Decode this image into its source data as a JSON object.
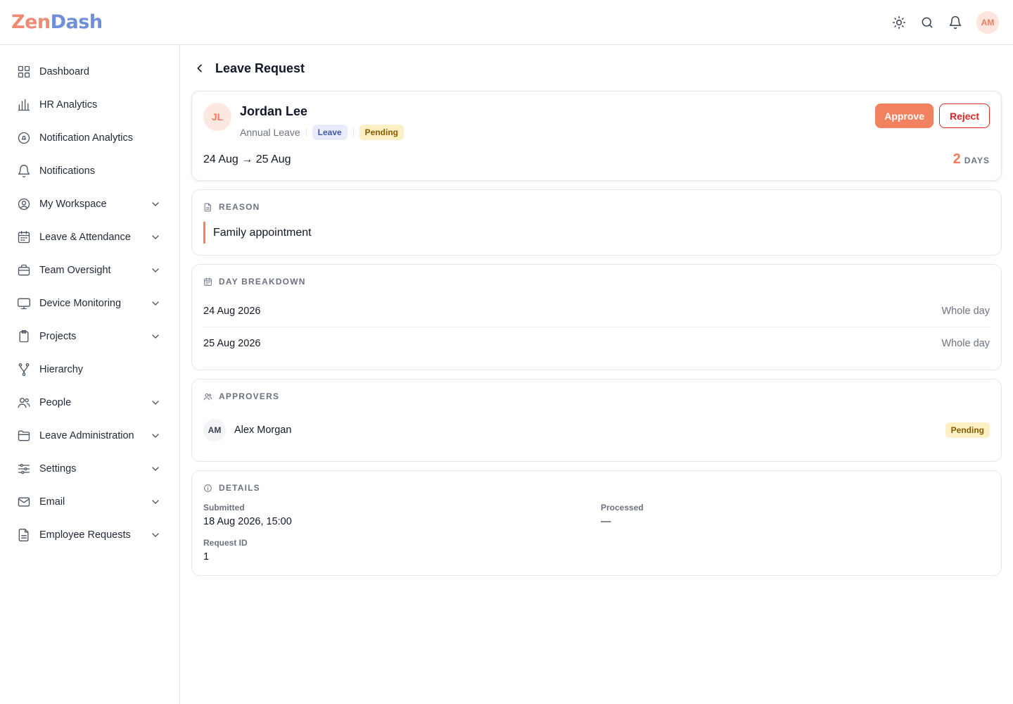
{
  "app": {
    "logo_part1": "Zen",
    "logo_part2": "Dash",
    "user_initials": "AM"
  },
  "topbar_icons": [
    "sun-icon",
    "search-icon",
    "bell-icon"
  ],
  "sidebar": {
    "items": [
      {
        "label": "Dashboard",
        "icon": "grid-icon",
        "expandable": false
      },
      {
        "label": "HR Analytics",
        "icon": "bar-chart-icon",
        "expandable": false
      },
      {
        "label": "Notification Analytics",
        "icon": "circle-bell-icon",
        "expandable": false
      },
      {
        "label": "Notifications",
        "icon": "bell-icon",
        "expandable": false
      },
      {
        "label": "My Workspace",
        "icon": "user-circle-icon",
        "expandable": true
      },
      {
        "label": "Leave & Attendance",
        "icon": "calendar-icon",
        "expandable": true
      },
      {
        "label": "Team Oversight",
        "icon": "briefcase-icon",
        "expandable": true
      },
      {
        "label": "Device Monitoring",
        "icon": "monitor-icon",
        "expandable": true
      },
      {
        "label": "Projects",
        "icon": "clipboard-icon",
        "expandable": true
      },
      {
        "label": "Hierarchy",
        "icon": "fork-icon",
        "expandable": false
      },
      {
        "label": "People",
        "icon": "users-icon",
        "expandable": true
      },
      {
        "label": "Leave Administration",
        "icon": "folder-icon",
        "expandable": true
      },
      {
        "label": "Settings",
        "icon": "sliders-icon",
        "expandable": true
      },
      {
        "label": "Email",
        "icon": "mail-icon",
        "expandable": true
      },
      {
        "label": "Employee Requests",
        "icon": "document-icon",
        "expandable": true
      }
    ]
  },
  "page": {
    "title": "Leave Request"
  },
  "request": {
    "initials": "JL",
    "name": "Jordan Lee",
    "leave_type": "Annual Leave",
    "category_badge": "Leave",
    "status_badge": "Pending",
    "date_range": "24 Aug → 25 Aug",
    "days_count": "2",
    "days_unit": "DAYS",
    "approve_label": "Approve",
    "reject_label": "Reject"
  },
  "reason": {
    "title": "REASON",
    "text": "Family appointment"
  },
  "breakdown": {
    "title": "DAY BREAKDOWN",
    "rows": [
      {
        "date": "24 Aug 2026",
        "type": "Whole day"
      },
      {
        "date": "25 Aug 2026",
        "type": "Whole day"
      }
    ]
  },
  "approvers": {
    "title": "APPROVERS",
    "list": [
      {
        "initials": "AM",
        "name": "Alex Morgan",
        "status": "Pending"
      }
    ]
  },
  "details": {
    "title": "DETAILS",
    "submitted_label": "Submitted",
    "submitted_value": "18 Aug 2026, 15:00",
    "processed_label": "Processed",
    "processed_value": "—",
    "request_id_label": "Request ID",
    "request_id_value": "1"
  },
  "colors": {
    "accent": "#f2815f",
    "danger": "#dc2626",
    "pending_bg": "#fdf0c4",
    "leave_bg": "#e8ecfb"
  }
}
